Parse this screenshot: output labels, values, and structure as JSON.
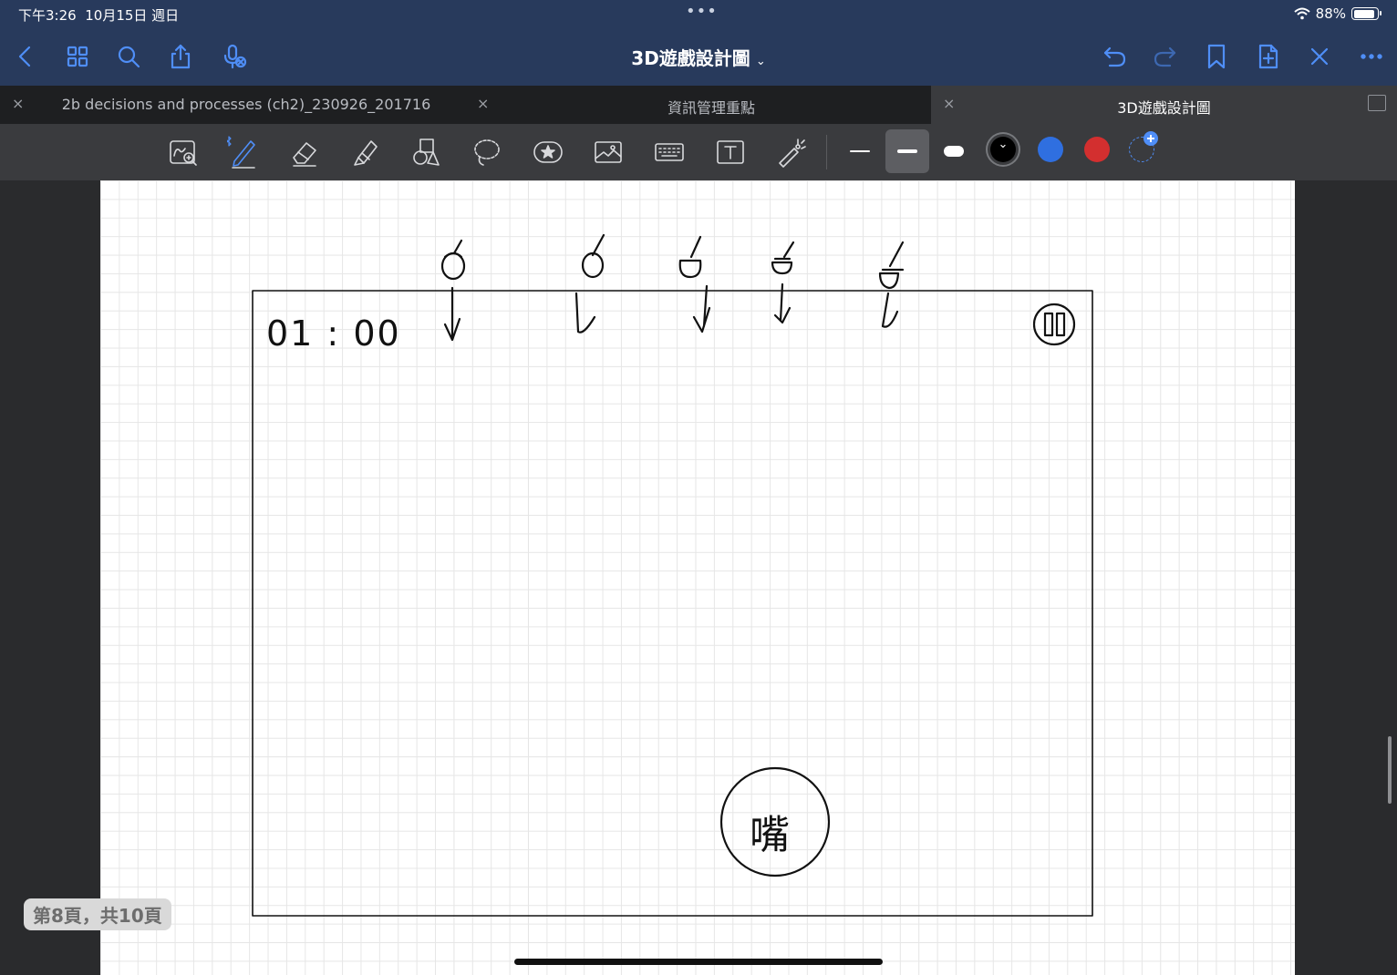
{
  "status_bar": {
    "time": "下午3:26",
    "date": "10月15日 週日",
    "dots": "•••",
    "battery": "88%",
    "battery_level": 0.88
  },
  "nav": {
    "title": "3D遊戲設計圖",
    "chevron": "⌄",
    "left_icons": [
      "back-icon",
      "grid-icon",
      "search-icon",
      "share-icon",
      "microphone-icon"
    ],
    "right_icons": [
      "undo-icon",
      "redo-icon",
      "bookmark-icon",
      "add-page-icon",
      "close-icon",
      "more-icon"
    ]
  },
  "tabs": [
    {
      "label": "2b decisions and processes (ch2)_230926_201716",
      "close": "×",
      "active": false
    },
    {
      "label": "資訊管理重點",
      "close": "×",
      "active": false
    },
    {
      "label": "3D遊戲設計圖",
      "close": "×",
      "active": true
    }
  ],
  "toolbar": {
    "tools": [
      "zoom-window-icon",
      "pen-icon",
      "eraser-icon",
      "highlighter-icon",
      "shapes-icon",
      "lasso-icon",
      "sticker-icon",
      "image-icon",
      "keyboard-icon",
      "text-box-icon",
      "laser-pointer-icon"
    ],
    "selected_tool": "pen-icon",
    "colors": {
      "black": "#000000",
      "blue": "#2f6fe0",
      "red": "#d32f2f",
      "accent": "#4f8ef7"
    }
  },
  "page": {
    "timer_text": "01 : 00",
    "mouth_char": "嘴",
    "indicator": "第8頁，共10頁"
  }
}
